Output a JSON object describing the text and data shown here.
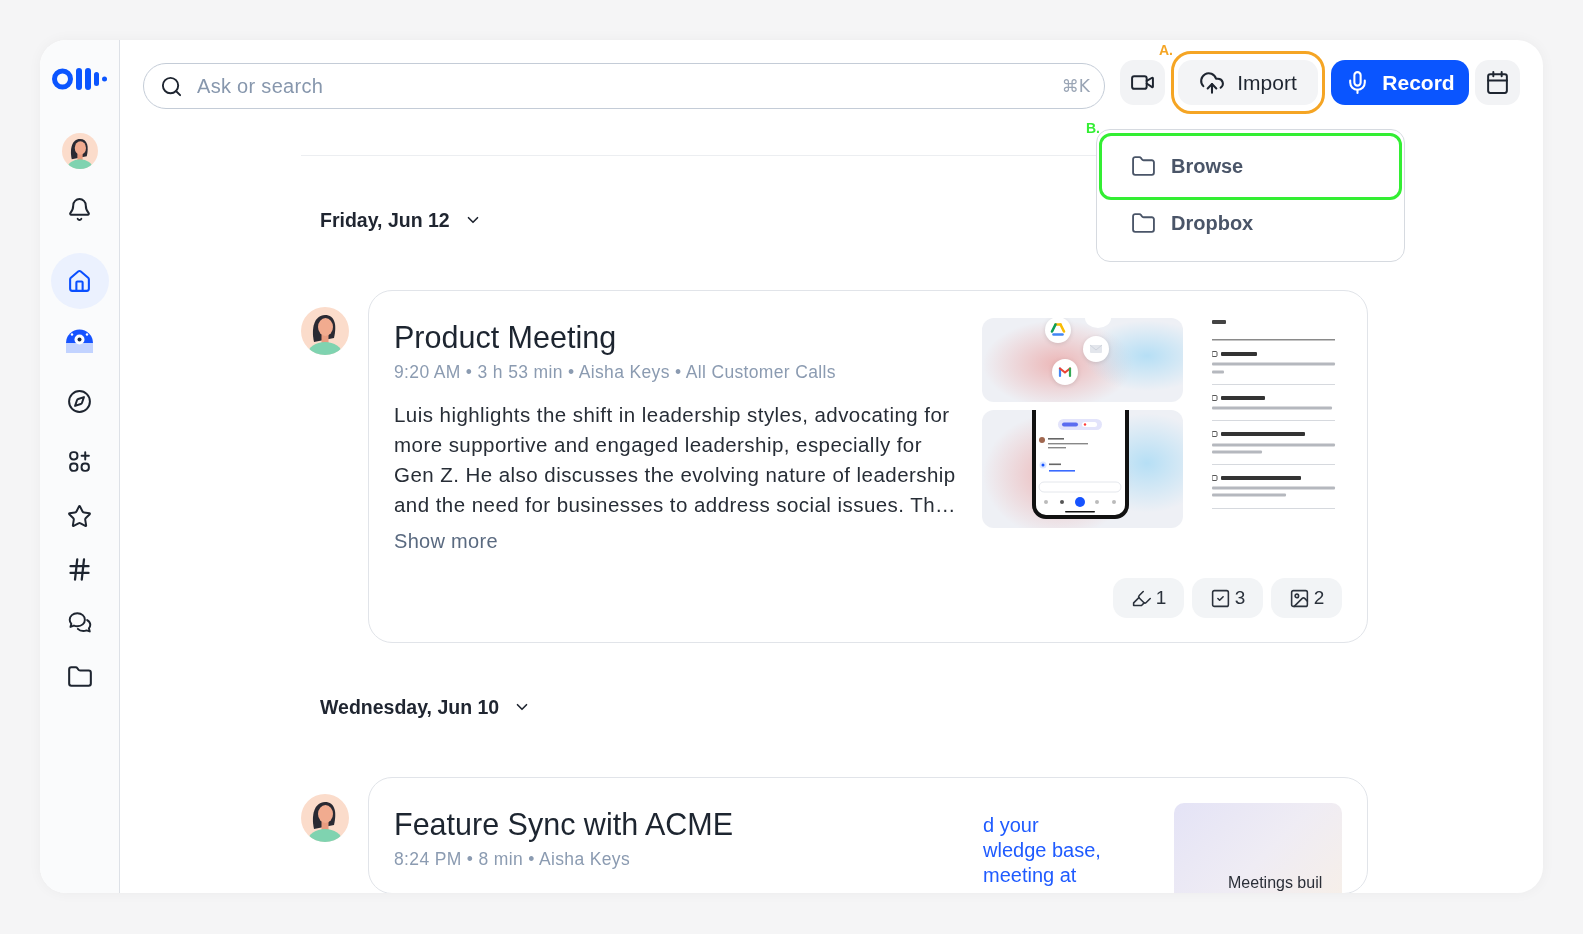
{
  "sidebar": {
    "items": [
      {
        "kind": "notifications",
        "selected": false
      },
      {
        "kind": "home",
        "selected": true
      },
      {
        "kind": "assistant",
        "selected": false
      },
      {
        "kind": "explore",
        "selected": false
      },
      {
        "kind": "apps",
        "selected": false
      },
      {
        "kind": "starred",
        "selected": false
      },
      {
        "kind": "channels",
        "selected": false
      },
      {
        "kind": "chats",
        "selected": false
      },
      {
        "kind": "folders",
        "selected": false
      }
    ]
  },
  "header": {
    "search": {
      "placeholder": "Ask or search",
      "shortcut": "⌘K"
    },
    "buttons": [
      {
        "kind": "video"
      },
      {
        "kind": "import",
        "label": "Import",
        "annotation": {
          "label": "A.",
          "color": "#f5a524"
        }
      },
      {
        "kind": "record",
        "label": "Record"
      },
      {
        "kind": "calendar"
      }
    ]
  },
  "import_menu": {
    "items": [
      {
        "label": "Browse",
        "annotation": {
          "label": "B.",
          "color": "#33ee33"
        }
      },
      {
        "label": "Dropbox"
      }
    ]
  },
  "feed": [
    {
      "date": "Friday, Jun 12",
      "expanded": true,
      "meetings": [
        {
          "title": "Product Meeting",
          "meta": "9:20 AM • 3 h 53 min • Aisha Keys • All Customer Calls",
          "summary": "Luis highlights the shift in leadership styles, advocating for more supportive and engaged leadership, especially for Gen Z. He also discusses the evolving nature of leadership and the need for businesses to address social issues. Th…",
          "show_more": "Show more",
          "media": [
            {
              "kind": "integrations"
            },
            {
              "kind": "phone"
            },
            {
              "kind": "document"
            }
          ],
          "badges": [
            {
              "kind": "highlights",
              "count": "1"
            },
            {
              "kind": "action_items",
              "count": "3"
            },
            {
              "kind": "images",
              "count": "2"
            }
          ]
        }
      ]
    },
    {
      "date": "Wednesday, Jun 10",
      "expanded": true,
      "meetings": [
        {
          "title": "Feature Sync with ACME",
          "meta": "8:24 PM • 8 min • Aisha Keys",
          "media": [
            {
              "kind": "excerpt",
              "lines": [
                "d your",
                "wledge base,",
                "meeting at"
              ]
            },
            {
              "kind": "photo",
              "caption": "Meetings buil"
            }
          ]
        }
      ]
    }
  ]
}
